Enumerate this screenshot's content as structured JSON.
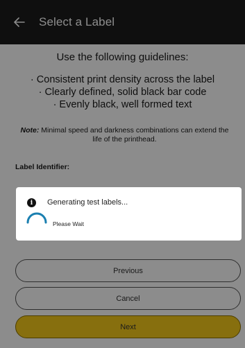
{
  "appbar": {
    "title": "Select a Label",
    "back_icon": "arrow-left-icon"
  },
  "guidelines": {
    "heading": "Use the following guidelines:",
    "items": [
      "· Consistent print density across the label",
      "· Clearly defined, solid black bar code",
      "· Evenly black, well formed text"
    ]
  },
  "note": {
    "prefix": "Note:",
    "text": " Minimal speed and darkness combinations can extend the life of the printhead."
  },
  "label_identifier": {
    "label": "Label Identifier:"
  },
  "buttons": {
    "previous": "Previous",
    "cancel": "Cancel",
    "next": "Next"
  },
  "dialog": {
    "title": "Generating test labels...",
    "subtitle": "Please Wait",
    "icon": "info-icon",
    "spinner": "loading-spinner-icon"
  },
  "colors": {
    "appbar_bg": "#1c1c1c",
    "next_button": "#f6cb1a",
    "spinner": "#1a7fb0"
  }
}
